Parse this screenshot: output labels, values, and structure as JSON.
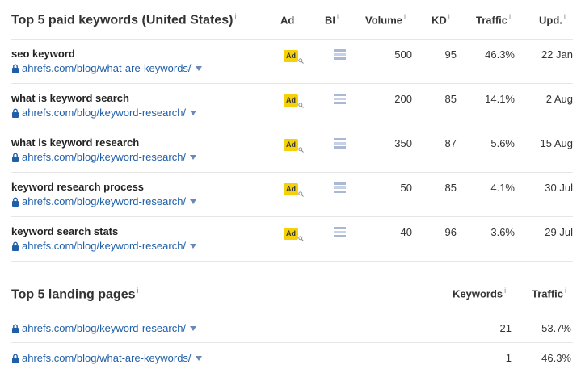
{
  "paid_keywords": {
    "title": "Top 5 paid keywords (United States)",
    "columns": {
      "ad": "Ad",
      "bl": "BI",
      "volume": "Volume",
      "kd": "KD",
      "traffic": "Traffic",
      "updated": "Upd."
    },
    "info_glyph": "i",
    "ad_badge": "Ad",
    "rows": [
      {
        "keyword": "seo keyword",
        "url": "ahrefs.com/blog/what-are-keywords/",
        "volume": "500",
        "kd": "95",
        "traffic": "46.3%",
        "updated": "22 Jan"
      },
      {
        "keyword": "what is keyword search",
        "url": "ahrefs.com/blog/keyword-research/",
        "volume": "200",
        "kd": "85",
        "traffic": "14.1%",
        "updated": "2 Aug"
      },
      {
        "keyword": "what is keyword research",
        "url": "ahrefs.com/blog/keyword-research/",
        "volume": "350",
        "kd": "87",
        "traffic": "5.6%",
        "updated": "15 Aug"
      },
      {
        "keyword": "keyword research process",
        "url": "ahrefs.com/blog/keyword-research/",
        "volume": "50",
        "kd": "85",
        "traffic": "4.1%",
        "updated": "30 Jul"
      },
      {
        "keyword": "keyword search stats",
        "url": "ahrefs.com/blog/keyword-research/",
        "volume": "40",
        "kd": "96",
        "traffic": "3.6%",
        "updated": "29 Jul"
      }
    ]
  },
  "landing_pages": {
    "title": "Top 5 landing pages",
    "columns": {
      "keywords": "Keywords",
      "traffic": "Traffic"
    },
    "rows": [
      {
        "url": "ahrefs.com/blog/keyword-research/",
        "keywords": "21",
        "traffic": "53.7%"
      },
      {
        "url": "ahrefs.com/blog/what-are-keywords/",
        "keywords": "1",
        "traffic": "46.3%"
      }
    ]
  },
  "colors": {
    "link": "#1f5ea8",
    "ad_badge": "#f5d10a",
    "divider": "#e6e6e6"
  },
  "icons": {
    "lock": "lock-icon",
    "caret": "chevron-down-icon",
    "magnifier": "magnifier-icon",
    "backlinks": "list-icon"
  }
}
